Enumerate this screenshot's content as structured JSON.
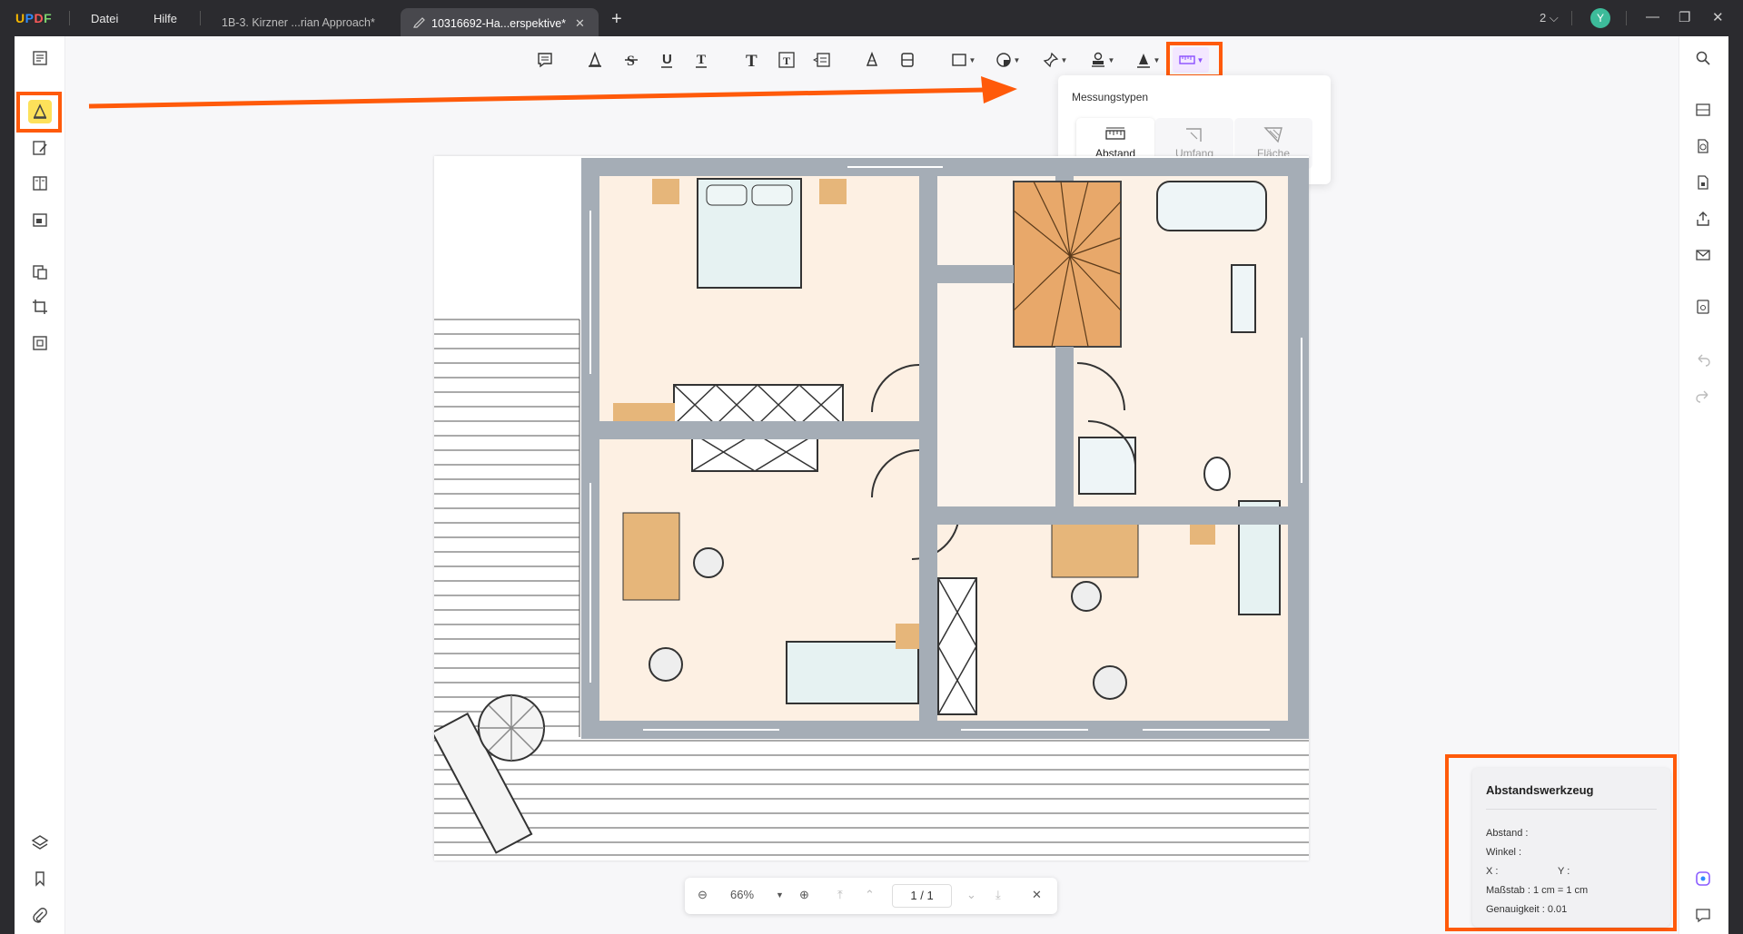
{
  "app": {
    "logo": "UPDF",
    "menu": [
      "Datei",
      "Hilfe"
    ],
    "tabs": [
      {
        "label": "1B-3. Kirzner ...rian Approach*",
        "active": false
      },
      {
        "label": "10316692-Ha...erspektive*",
        "active": true
      }
    ],
    "window_count": "2",
    "avatar_letter": "Y",
    "accent_color": "#ff5a0a"
  },
  "toolbar": {
    "tools": [
      "comment-icon",
      "highlight-icon",
      "strikethrough-icon",
      "underline-icon",
      "squiggly-icon",
      "text-icon",
      "textbox-icon",
      "text-callout-icon",
      "pencil-icon",
      "eraser-icon",
      "shape-icon",
      "shape2-icon",
      "pin-icon",
      "stamp-icon",
      "signature-icon",
      "measure-icon"
    ]
  },
  "measure_popup": {
    "title": "Messungstypen",
    "types": [
      {
        "label": "Abstand",
        "selected": true
      },
      {
        "label": "Umfang",
        "selected": false
      },
      {
        "label": "Fläche",
        "selected": false
      }
    ]
  },
  "zoom": {
    "value": "66%",
    "page_current": "1",
    "page_sep": "/",
    "page_total": "1"
  },
  "distance_panel": {
    "title": "Abstandswerkzeug",
    "distance_label": "Abstand :",
    "angle_label": "Winkel :",
    "x_label": "X :",
    "y_label": "Y :",
    "scale_label": "Maßstab : 1 cm = 1 cm",
    "precision_label": "Genauigkeit : 0.01"
  }
}
